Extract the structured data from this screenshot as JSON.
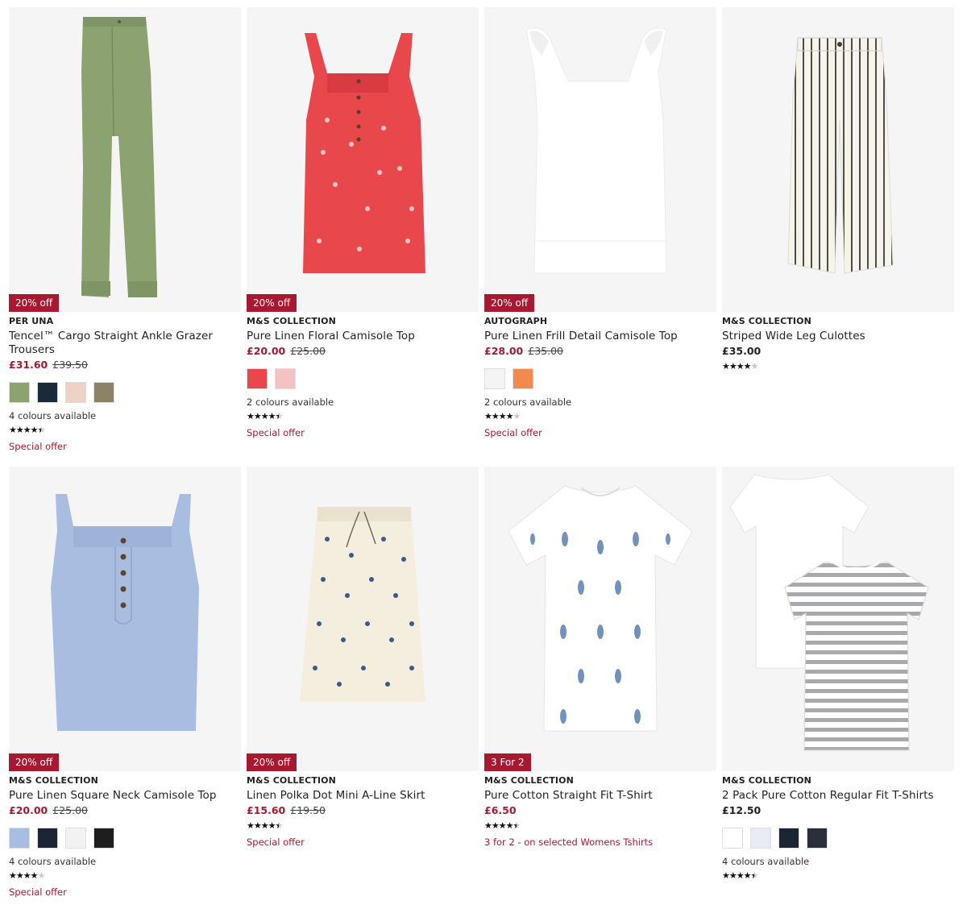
{
  "products": [
    {
      "badge": "20% off",
      "brand": "PER UNA",
      "title": "Tencel™ Cargo Straight Ankle Grazer Trousers",
      "price": "£31.60",
      "was_price": "£39.50",
      "swatches": [
        "#8da271",
        "#1b2a38",
        "#ecd3c5",
        "#8c8268"
      ],
      "colours_text": "4 colours available",
      "rating": 4.5,
      "offer_text": "Special offer",
      "image_icon": "cargo-trousers-image"
    },
    {
      "badge": "20% off",
      "brand": "M&S COLLECTION",
      "title": "Pure Linen Floral Camisole Top",
      "price": "£20.00",
      "was_price": "£25.00",
      "swatches": [
        "#e8474c",
        "#f3c2c4"
      ],
      "colours_text": "2 colours available",
      "rating": 4.5,
      "offer_text": "Special offer",
      "image_icon": "floral-camisole-image"
    },
    {
      "badge": "20% off",
      "brand": "AUTOGRAPH",
      "title": "Pure Linen Frill Detail Camisole Top",
      "price": "£28.00",
      "was_price": "£35.00",
      "swatches": [
        "#f4f4f4",
        "#f2894d"
      ],
      "colours_text": "2 colours available",
      "rating": 4,
      "offer_text": "Special offer",
      "image_icon": "frill-camisole-image"
    },
    {
      "badge": "",
      "brand": "M&S COLLECTION",
      "title": "Striped Wide Leg Culottes",
      "price": "£35.00",
      "was_price": "",
      "swatches": [],
      "colours_text": "",
      "rating": 4,
      "offer_text": "",
      "image_icon": "striped-culottes-image"
    },
    {
      "badge": "20% off",
      "brand": "M&S COLLECTION",
      "title": "Pure Linen Square Neck Camisole Top",
      "price": "£20.00",
      "was_price": "£25.00",
      "swatches": [
        "#a9bde0",
        "#1b2533",
        "#f2f2f2",
        "#1e1e1e"
      ],
      "colours_text": "4 colours available",
      "rating": 4,
      "offer_text": "Special offer",
      "image_icon": "linen-camisole-image"
    },
    {
      "badge": "20% off",
      "brand": "M&S COLLECTION",
      "title": "Linen Polka Dot Mini A-Line Skirt",
      "price": "£15.60",
      "was_price": "£19.50",
      "swatches": [],
      "colours_text": "",
      "rating": 4.5,
      "offer_text": "Special offer",
      "image_icon": "polka-skirt-image"
    },
    {
      "badge": "3 For 2",
      "brand": "M&S COLLECTION",
      "title": "Pure Cotton Straight Fit T-Shirt",
      "price": "£6.50",
      "was_price": "",
      "swatches": [],
      "colours_text": "",
      "rating": 4.5,
      "offer_text": "3 for 2 - on selected Womens Tshirts",
      "image_icon": "paisley-tshirt-image"
    },
    {
      "badge": "",
      "brand": "M&S COLLECTION",
      "title": "2 Pack Pure Cotton Regular Fit T-Shirts",
      "price": "£12.50",
      "was_price": "",
      "swatches": [
        "#ffffff",
        "#e9edf3",
        "#1b2533",
        "#2a2f3c"
      ],
      "colours_text": "4 colours available",
      "rating": 4.5,
      "offer_text": "",
      "image_icon": "tshirt-pack-image"
    }
  ],
  "colors": {
    "accent": "#a71930",
    "image_bg": "#f5f5f5"
  }
}
